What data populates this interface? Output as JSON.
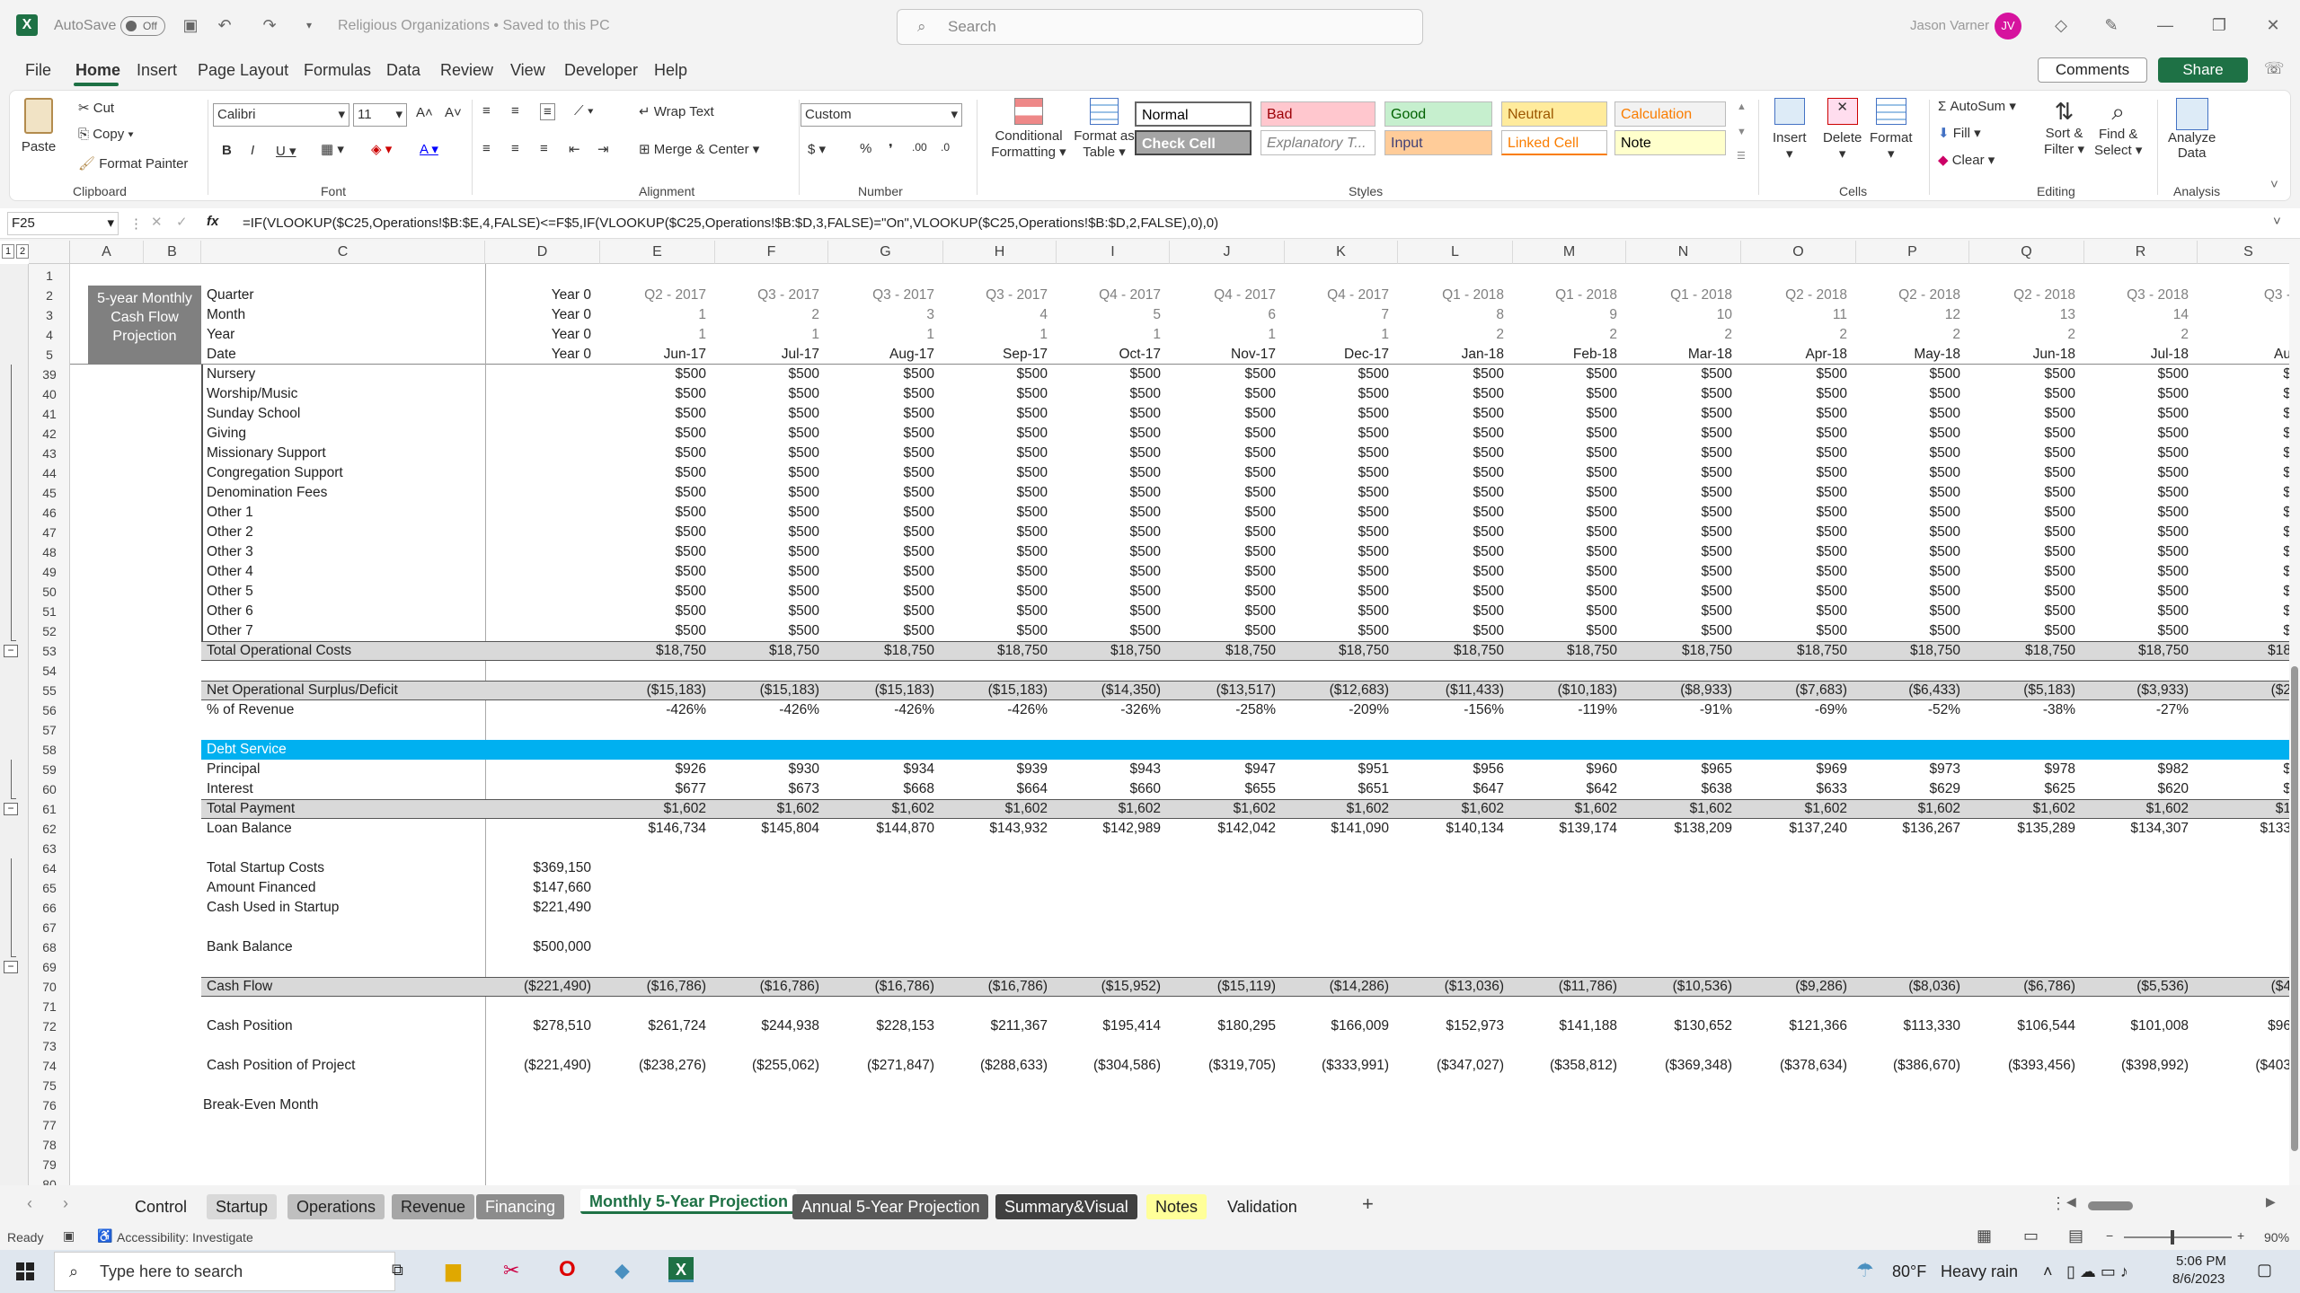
{
  "title": {
    "autosave": "AutoSave",
    "toggle": "Off",
    "doc": "Religious Organizations • Saved to this PC",
    "user": "Jason Varner",
    "initials": "JV"
  },
  "search": {
    "placeholder": "Search"
  },
  "menu": [
    "File",
    "Home",
    "Insert",
    "Page Layout",
    "Formulas",
    "Data",
    "Review",
    "View",
    "Developer",
    "Help"
  ],
  "menu_right": {
    "comments": "Comments",
    "share": "Share"
  },
  "ribbon": {
    "paste": "Paste",
    "cut": "Cut",
    "copy": "Copy",
    "format_painter": "Format Painter",
    "clipboard": "Clipboard",
    "font_name": "Calibri",
    "font_size": "11",
    "font": "Font",
    "wrap": "Wrap Text",
    "merge": "Merge & Center",
    "alignment": "Alignment",
    "numfmt": "Custom",
    "number": "Number",
    "cond": "Conditional",
    "cond2": "Formatting",
    "fmt_table": "Format as",
    "fmt_table2": "Table",
    "styles": [
      {
        "label": "Normal",
        "bg": "#ffffff",
        "fg": "#000000"
      },
      {
        "label": "Bad",
        "bg": "#ffc7ce",
        "fg": "#9c0006"
      },
      {
        "label": "Good",
        "bg": "#c6efce",
        "fg": "#006100"
      },
      {
        "label": "Neutral",
        "bg": "#ffeb9c",
        "fg": "#9c5700"
      },
      {
        "label": "Calculation",
        "bg": "#f2f2f2",
        "fg": "#fa7d00"
      },
      {
        "label": "Check Cell",
        "bg": "#a5a5a5",
        "fg": "#ffffff"
      },
      {
        "label": "Explanatory T...",
        "bg": "#ffffff",
        "fg": "#7f7f7f"
      },
      {
        "label": "Input",
        "bg": "#ffcc99",
        "fg": "#3f3f76"
      },
      {
        "label": "Linked Cell",
        "bg": "#ffffff",
        "fg": "#fa7d00"
      },
      {
        "label": "Note",
        "bg": "#ffffcc",
        "fg": "#000000"
      }
    ],
    "styles_label": "Styles",
    "insert": "Insert",
    "delete": "Delete",
    "format": "Format",
    "cells": "Cells",
    "autosum": "AutoSum",
    "fill": "Fill",
    "clear": "Clear",
    "sort": "Sort &",
    "sort2": "Filter",
    "find": "Find &",
    "find2": "Select",
    "editing": "Editing",
    "analyze": "Analyze",
    "analyze2": "Data",
    "analysis": "Analysis"
  },
  "formula": {
    "namebox": "F25",
    "fx": "fx",
    "text": "=IF(VLOOKUP($C25,Operations!$B:$E,4,FALSE)<=F$5,IF(VLOOKUP($C25,Operations!$B:$D,3,FALSE)=\"On\",VLOOKUP($C25,Operations!$B:$D,2,FALSE),0),0)"
  },
  "columns": [
    "A",
    "B",
    "C",
    "D",
    "E",
    "F",
    "G",
    "H",
    "I",
    "J",
    "K",
    "L",
    "M",
    "N",
    "O",
    "P",
    "Q",
    "R",
    "S"
  ],
  "side_label": [
    "5-year Monthly",
    "Cash Flow",
    "Projection"
  ],
  "header_rows": [
    {
      "row": "1",
      "label": "",
      "d": "",
      "vals": []
    },
    {
      "row": "2",
      "label": "Quarter",
      "d": "Year 0",
      "vals": [
        "Q2 - 2017",
        "Q3 - 2017",
        "Q3 - 2017",
        "Q3 - 2017",
        "Q4 - 2017",
        "Q4 - 2017",
        "Q4 - 2017",
        "Q1 - 2018",
        "Q1 - 2018",
        "Q1 - 2018",
        "Q2 - 2018",
        "Q2 - 2018",
        "Q2 - 2018",
        "Q3 - 2018",
        "Q3 -"
      ]
    },
    {
      "row": "3",
      "label": "Month",
      "d": "Year 0",
      "vals": [
        "1",
        "2",
        "3",
        "4",
        "5",
        "6",
        "7",
        "8",
        "9",
        "10",
        "11",
        "12",
        "13",
        "14",
        ""
      ]
    },
    {
      "row": "4",
      "label": "Year",
      "d": "Year 0",
      "vals": [
        "1",
        "1",
        "1",
        "1",
        "1",
        "1",
        "1",
        "2",
        "2",
        "2",
        "2",
        "2",
        "2",
        "2",
        ""
      ]
    },
    {
      "row": "5",
      "label": "Date",
      "d": "Year 0",
      "vals": [
        "Jun-17",
        "Jul-17",
        "Aug-17",
        "Sep-17",
        "Oct-17",
        "Nov-17",
        "Dec-17",
        "Jan-18",
        "Feb-18",
        "Mar-18",
        "Apr-18",
        "May-18",
        "Jun-18",
        "Jul-18",
        "Au"
      ]
    }
  ],
  "cost_rows": [
    {
      "row": "39",
      "label": "Nursery"
    },
    {
      "row": "40",
      "label": "Worship/Music"
    },
    {
      "row": "41",
      "label": "Sunday School"
    },
    {
      "row": "42",
      "label": "Giving"
    },
    {
      "row": "43",
      "label": "Missionary Support"
    },
    {
      "row": "44",
      "label": "Congregation Support"
    },
    {
      "row": "45",
      "label": "Denomination Fees"
    },
    {
      "row": "46",
      "label": "Other 1"
    },
    {
      "row": "47",
      "label": "Other 2"
    },
    {
      "row": "48",
      "label": "Other 3"
    },
    {
      "row": "49",
      "label": "Other 4"
    },
    {
      "row": "50",
      "label": "Other 5"
    },
    {
      "row": "51",
      "label": "Other 6"
    },
    {
      "row": "52",
      "label": "Other 7"
    }
  ],
  "cost_value": "$500",
  "cost_partial": "$",
  "total_ops": {
    "row": "53",
    "label": "Total Operational Costs",
    "value": "$18,750",
    "partial": "$18"
  },
  "surplus": {
    "row": "55",
    "label": "Net Operational Surplus/Deficit",
    "vals": [
      "($15,183)",
      "($15,183)",
      "($15,183)",
      "($15,183)",
      "($14,350)",
      "($13,517)",
      "($12,683)",
      "($11,433)",
      "($10,183)",
      "($8,933)",
      "($7,683)",
      "($6,433)",
      "($5,183)",
      "($3,933)",
      "($2"
    ]
  },
  "pct": {
    "row": "56",
    "label": "% of Revenue",
    "vals": [
      "-426%",
      "-426%",
      "-426%",
      "-426%",
      "-326%",
      "-258%",
      "-209%",
      "-156%",
      "-119%",
      "-91%",
      "-69%",
      "-52%",
      "-38%",
      "-27%",
      ""
    ]
  },
  "debt": {
    "row": "58",
    "label": "Debt Service"
  },
  "principal": {
    "row": "59",
    "label": "Principal",
    "vals": [
      "$926",
      "$930",
      "$934",
      "$939",
      "$943",
      "$947",
      "$951",
      "$956",
      "$960",
      "$965",
      "$969",
      "$973",
      "$978",
      "$982",
      "$"
    ]
  },
  "interest": {
    "row": "60",
    "label": "Interest",
    "vals": [
      "$677",
      "$673",
      "$668",
      "$664",
      "$660",
      "$655",
      "$651",
      "$647",
      "$642",
      "$638",
      "$633",
      "$629",
      "$625",
      "$620",
      "$"
    ]
  },
  "total_pay": {
    "row": "61",
    "label": "Total Payment",
    "value": "$1,602",
    "partial": "$1"
  },
  "loan": {
    "row": "62",
    "label": "Loan Balance",
    "vals": [
      "$146,734",
      "$145,804",
      "$144,870",
      "$143,932",
      "$142,989",
      "$142,042",
      "$141,090",
      "$140,134",
      "$139,174",
      "$138,209",
      "$137,240",
      "$136,267",
      "$135,289",
      "$134,307",
      "$133"
    ]
  },
  "startup": [
    {
      "row": "64",
      "label": "Total Startup Costs",
      "d": "$369,150"
    },
    {
      "row": "65",
      "label": "Amount Financed",
      "d": "$147,660"
    },
    {
      "row": "66",
      "label": "Cash Used in Startup",
      "d": "$221,490"
    },
    {
      "row": "68",
      "label": "Bank Balance",
      "d": "$500,000"
    }
  ],
  "cashflow": {
    "row": "70",
    "label": "Cash Flow",
    "d": "($221,490)",
    "vals": [
      "($16,786)",
      "($16,786)",
      "($16,786)",
      "($16,786)",
      "($15,952)",
      "($15,119)",
      "($14,286)",
      "($13,036)",
      "($11,786)",
      "($10,536)",
      "($9,286)",
      "($8,036)",
      "($6,786)",
      "($5,536)",
      "($4"
    ]
  },
  "cashpos": {
    "row": "72",
    "label": "Cash Position",
    "d": "$278,510",
    "vals": [
      "$261,724",
      "$244,938",
      "$228,153",
      "$211,367",
      "$195,414",
      "$180,295",
      "$166,009",
      "$152,973",
      "$141,188",
      "$130,652",
      "$121,366",
      "$113,330",
      "$106,544",
      "$101,008",
      "$96"
    ]
  },
  "cashproj": {
    "row": "74",
    "label": "Cash Position of Project",
    "d": "($221,490)",
    "vals": [
      "($238,276)",
      "($255,062)",
      "($271,847)",
      "($288,633)",
      "($304,586)",
      "($319,705)",
      "($333,991)",
      "($347,027)",
      "($358,812)",
      "($369,348)",
      "($378,634)",
      "($386,670)",
      "($393,456)",
      "($398,992)",
      "($403"
    ]
  },
  "breakeven": {
    "row": "76",
    "label": "Break-Even Month"
  },
  "empty_rows": [
    "54",
    "57",
    "63",
    "67",
    "69",
    "71",
    "73",
    "75",
    "77",
    "78",
    "79",
    "80"
  ],
  "outline": [
    "1",
    "2"
  ],
  "tabs": [
    {
      "label": "Control",
      "bg": "transparent",
      "fg": "#222"
    },
    {
      "label": "Startup",
      "bg": "#d9d9d9",
      "fg": "#222"
    },
    {
      "label": "Operations",
      "bg": "#bfbfbf",
      "fg": "#222"
    },
    {
      "label": "Revenue",
      "bg": "#a6a6a6",
      "fg": "#222"
    },
    {
      "label": "Financing",
      "bg": "#8c8c8c",
      "fg": "#fff"
    },
    {
      "label": "Monthly 5-Year Projection",
      "bg": "#ffffff",
      "fg": "#1e7145"
    },
    {
      "label": "Annual 5-Year Projection",
      "bg": "#595959",
      "fg": "#fff"
    },
    {
      "label": "Summary&Visual",
      "bg": "#404040",
      "fg": "#fff"
    },
    {
      "label": "Notes",
      "bg": "#ffff99",
      "fg": "#222"
    },
    {
      "label": "Validation",
      "bg": "transparent",
      "fg": "#222"
    }
  ],
  "add_tab": "+",
  "status": {
    "ready": "Ready",
    "access": "Accessibility: Investigate",
    "zoom": "90%"
  },
  "taskbar": {
    "search": "Type here to search",
    "weather_temp": "80°F",
    "weather": "Heavy rain",
    "time": "5:06 PM",
    "date": "8/6/2023"
  }
}
